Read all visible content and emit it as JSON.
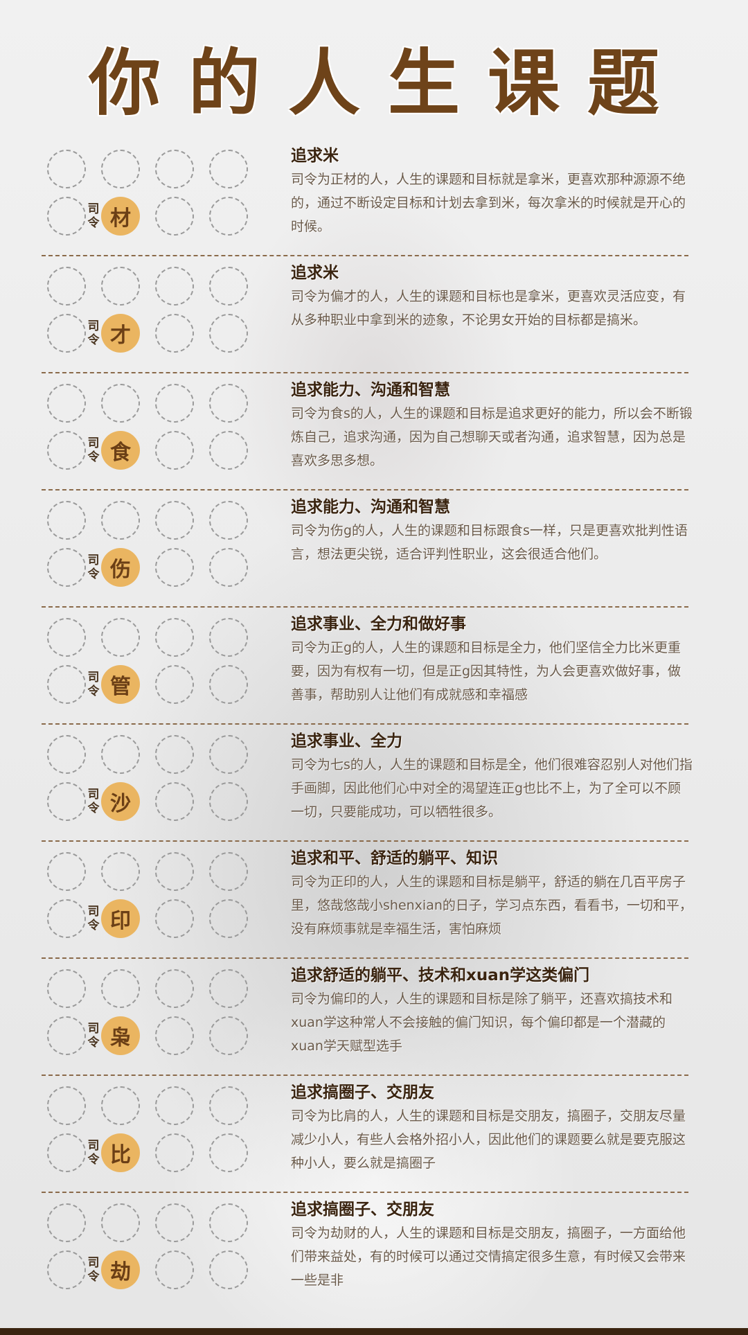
{
  "title": "你的人生课题",
  "sections": [
    {
      "role_label": "司令",
      "star": "材",
      "heading": "追求米",
      "description": "司令为正材的人，人生的课题和目标就是拿米，更喜欢那种源源不绝的，通过不断设定目标和计划去拿到米，每次拿米的时候就是开心的时候。"
    },
    {
      "role_label": "司令",
      "star": "才",
      "heading": "追求米",
      "description": "司令为偏才的人，人生的课题和目标也是拿米，更喜欢灵活应变，有从多种职业中拿到米的迹象，不论男女开始的目标都是搞米。"
    },
    {
      "role_label": "司令",
      "star": "食",
      "heading": "追求能力、沟通和智慧",
      "description": "司令为食s的人，人生的课题和目标是追求更好的能力，所以会不断锻炼自己，追求沟通，因为自己想聊天或者沟通，追求智慧，因为总是喜欢多思多想。"
    },
    {
      "role_label": "司令",
      "star": "伤",
      "heading": "追求能力、沟通和智慧",
      "description": "司令为伤g的人，人生的课题和目标跟食s一样，只是更喜欢批判性语言，想法更尖锐，适合评判性职业，这会很适合他们。"
    },
    {
      "role_label": "司令",
      "star": "管",
      "heading": "追求事业、全力和做好事",
      "description": "司令为正g的人，人生的课题和目标是全力，他们坚信全力比米更重要，因为有权有一切，但是正g因其特性，为人会更喜欢做好事，做善事，帮助别人让他们有成就感和幸福感"
    },
    {
      "role_label": "司令",
      "star": "沙",
      "heading": "追求事业、全力",
      "description": "司令为七s的人，人生的课题和目标是全，他们很难容忍别人对他们指手画脚，因此他们心中对全的渴望连正g也比不上，为了全可以不顾一切，只要能成功，可以牺牲很多。"
    },
    {
      "role_label": "司令",
      "star": "印",
      "heading": "追求和平、舒适的躺平、知识",
      "description": "司令为正印的人，人生的课题和目标是躺平，舒适的躺在几百平房子里，悠哉悠哉小shenxian的日子，学习点东西，看看书，一切和平，没有麻烦事就是幸福生活，害怕麻烦"
    },
    {
      "role_label": "司令",
      "star": "枭",
      "heading": "追求舒适的躺平、技术和xuan学这类偏门",
      "description": "司令为偏印的人，人生的课题和目标是除了躺平，还喜欢搞技术和xuan学这种常人不会接触的偏门知识，每个偏印都是一个潜藏的xuan学天赋型选手"
    },
    {
      "role_label": "司令",
      "star": "比",
      "heading": "追求搞圈子、交朋友",
      "description": "司令为比肩的人，人生的课题和目标是交朋友，搞圈子，交朋友尽量减少小人，有些人会格外招小人，因此他们的课题要么就是要克服这种小人，要么就是搞圈子"
    },
    {
      "role_label": "司令",
      "star": "劫",
      "heading": "追求搞圈子、交朋友",
      "description": "司令为劫财的人，人生的课题和目标是交朋友，搞圈子，一方面给他们带来益处，有的时候可以通过交情搞定很多生意，有时候又会带来一些是非"
    }
  ]
}
